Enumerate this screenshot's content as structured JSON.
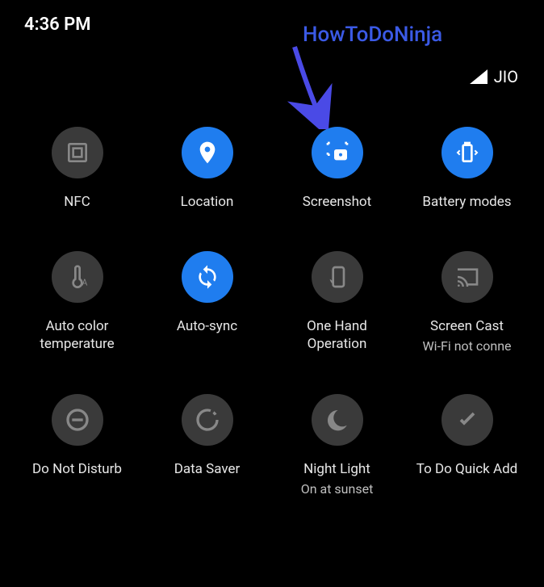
{
  "status": {
    "time": "4:36 PM",
    "carrier": "JIO"
  },
  "annotation": {
    "text": "HowToDoNinja"
  },
  "tiles": [
    {
      "label": "NFC",
      "sublabel": "",
      "active": false,
      "icon": "nfc"
    },
    {
      "label": "Location",
      "sublabel": "",
      "active": true,
      "icon": "location"
    },
    {
      "label": "Screenshot",
      "sublabel": "",
      "active": true,
      "icon": "screenshot"
    },
    {
      "label": "Battery modes",
      "sublabel": "",
      "active": true,
      "icon": "battery"
    },
    {
      "label": "Auto color temperature",
      "sublabel": "",
      "active": false,
      "icon": "autocolor"
    },
    {
      "label": "Auto-sync",
      "sublabel": "",
      "active": true,
      "icon": "autosync"
    },
    {
      "label": "One Hand Operation",
      "sublabel": "",
      "active": false,
      "icon": "onehand"
    },
    {
      "label": "Screen Cast",
      "sublabel": "Wi-Fi not conne",
      "active": false,
      "icon": "cast"
    },
    {
      "label": "Do Not Disturb",
      "sublabel": "",
      "active": false,
      "icon": "dnd"
    },
    {
      "label": "Data Saver",
      "sublabel": "",
      "active": false,
      "icon": "datasaver"
    },
    {
      "label": "Night Light",
      "sublabel": "On at sunset",
      "active": false,
      "icon": "nightlight"
    },
    {
      "label": "To Do Quick Add",
      "sublabel": "",
      "active": false,
      "icon": "todo"
    }
  ]
}
